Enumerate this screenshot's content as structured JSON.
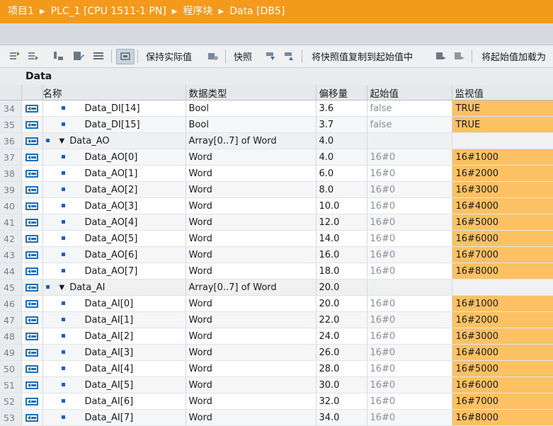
{
  "breadcrumb": [
    "项目1",
    "PLC_1 [CPU 1511-1 PN]",
    "程序块",
    "Data [DB5]"
  ],
  "toolbar": {
    "keep_actual": "保持实际值",
    "snapshot": "快照",
    "copy_snapshot": "将快照值复制到起始值中",
    "load_start": "将起始值加载为"
  },
  "db_title": "Data",
  "columns": {
    "name": "名称",
    "type": "数据类型",
    "offset": "偏移量",
    "start": "起始值",
    "monitor": "监视值"
  },
  "rows": [
    {
      "num": "34",
      "name": "Data_DI[14]",
      "type": "Bool",
      "offset": "3.6",
      "start": "false",
      "monitor": "TRUE",
      "group": false
    },
    {
      "num": "35",
      "name": "Data_DI[15]",
      "type": "Bool",
      "offset": "3.7",
      "start": "false",
      "monitor": "TRUE",
      "group": false
    },
    {
      "num": "36",
      "name": "Data_AO",
      "type": "Array[0..7] of Word",
      "offset": "4.0",
      "start": "",
      "monitor": "",
      "group": true
    },
    {
      "num": "37",
      "name": "Data_AO[0]",
      "type": "Word",
      "offset": "4.0",
      "start": "16#0",
      "monitor": "16#1000",
      "group": false
    },
    {
      "num": "38",
      "name": "Data_AO[1]",
      "type": "Word",
      "offset": "6.0",
      "start": "16#0",
      "monitor": "16#2000",
      "group": false
    },
    {
      "num": "39",
      "name": "Data_AO[2]",
      "type": "Word",
      "offset": "8.0",
      "start": "16#0",
      "monitor": "16#3000",
      "group": false
    },
    {
      "num": "40",
      "name": "Data_AO[3]",
      "type": "Word",
      "offset": "10.0",
      "start": "16#0",
      "monitor": "16#4000",
      "group": false
    },
    {
      "num": "41",
      "name": "Data_AO[4]",
      "type": "Word",
      "offset": "12.0",
      "start": "16#0",
      "monitor": "16#5000",
      "group": false
    },
    {
      "num": "42",
      "name": "Data_AO[5]",
      "type": "Word",
      "offset": "14.0",
      "start": "16#0",
      "monitor": "16#6000",
      "group": false
    },
    {
      "num": "43",
      "name": "Data_AO[6]",
      "type": "Word",
      "offset": "16.0",
      "start": "16#0",
      "monitor": "16#7000",
      "group": false
    },
    {
      "num": "44",
      "name": "Data_AO[7]",
      "type": "Word",
      "offset": "18.0",
      "start": "16#0",
      "monitor": "16#8000",
      "group": false
    },
    {
      "num": "45",
      "name": "Data_AI",
      "type": "Array[0..7] of Word",
      "offset": "20.0",
      "start": "",
      "monitor": "",
      "group": true
    },
    {
      "num": "46",
      "name": "Data_AI[0]",
      "type": "Word",
      "offset": "20.0",
      "start": "16#0",
      "monitor": "16#1000",
      "group": false
    },
    {
      "num": "47",
      "name": "Data_AI[1]",
      "type": "Word",
      "offset": "22.0",
      "start": "16#0",
      "monitor": "16#2000",
      "group": false
    },
    {
      "num": "48",
      "name": "Data_AI[2]",
      "type": "Word",
      "offset": "24.0",
      "start": "16#0",
      "monitor": "16#3000",
      "group": false
    },
    {
      "num": "49",
      "name": "Data_AI[3]",
      "type": "Word",
      "offset": "26.0",
      "start": "16#0",
      "monitor": "16#4000",
      "group": false
    },
    {
      "num": "50",
      "name": "Data_AI[4]",
      "type": "Word",
      "offset": "28.0",
      "start": "16#0",
      "monitor": "16#5000",
      "group": false
    },
    {
      "num": "51",
      "name": "Data_AI[5]",
      "type": "Word",
      "offset": "30.0",
      "start": "16#0",
      "monitor": "16#6000",
      "group": false
    },
    {
      "num": "52",
      "name": "Data_AI[6]",
      "type": "Word",
      "offset": "32.0",
      "start": "16#0",
      "monitor": "16#7000",
      "group": false
    },
    {
      "num": "53",
      "name": "Data_AI[7]",
      "type": "Word",
      "offset": "34.0",
      "start": "16#0",
      "monitor": "16#8000",
      "group": false
    }
  ],
  "colors": {
    "title_bar": "#f39a1c",
    "monitor_cell": "#fbc163",
    "element_icon": "#1d5fb8"
  }
}
